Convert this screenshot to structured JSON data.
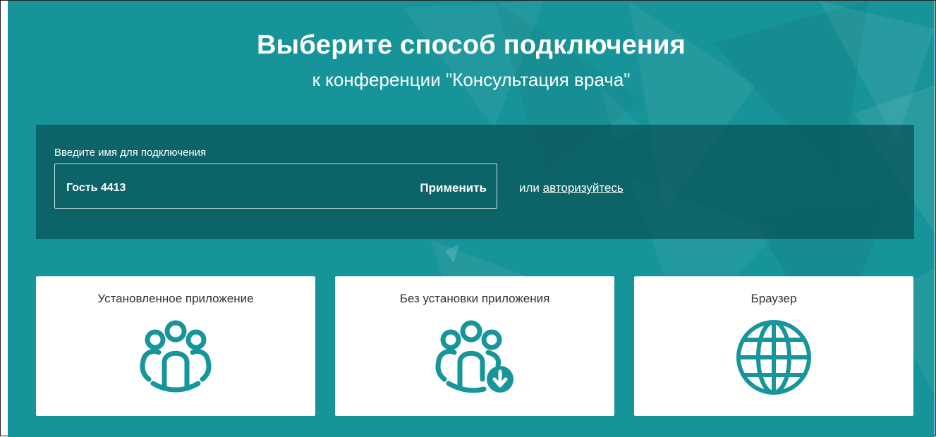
{
  "header": {
    "title": "Выберите способ подключения",
    "subtitle": "к конференции \"Консультация врача\""
  },
  "name_form": {
    "label": "Введите имя для подключения",
    "value": "Гость 4413",
    "apply_label": "Применить",
    "or_text": "или",
    "auth_link": "авторизуйтесь"
  },
  "options": [
    {
      "label": "Установленное приложение",
      "icon": "people-group-icon"
    },
    {
      "label": "Без установки приложения",
      "icon": "people-download-icon"
    },
    {
      "label": "Браузер",
      "icon": "globe-icon"
    }
  ],
  "colors": {
    "background": "#17949a",
    "accent": "#16959a",
    "form_panel": "#0d6f74",
    "card": "#ffffff"
  }
}
